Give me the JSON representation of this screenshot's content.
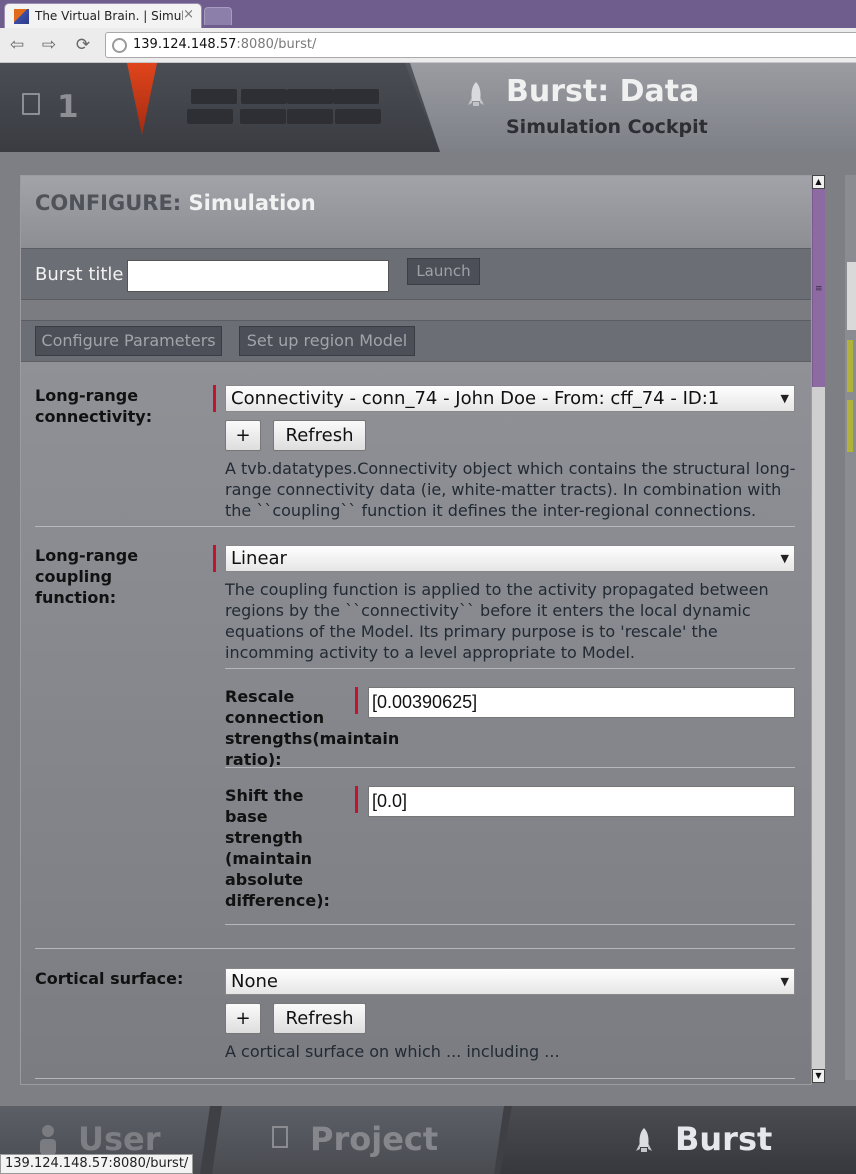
{
  "browser": {
    "tab_title": "The Virtual Brain. | Simulation",
    "tab_close": "×",
    "url_host": "139.124.148.57",
    "url_rest": ":8080/burst/",
    "status_url": "139.124.148.57:8080/burst/"
  },
  "header": {
    "project_count": "1",
    "title": "Burst: Data",
    "subtitle": "Simulation Cockpit"
  },
  "panel": {
    "configure_prefix": "CONFIGURE:",
    "configure_emph": "Simulation",
    "burst_title_label": "Burst title",
    "burst_title_value": "",
    "launch_label": "Launch",
    "configure_params_label": "Configure Parameters",
    "region_model_label": "Set up region Model"
  },
  "fields": {
    "connectivity": {
      "label": "Long-range connectivity:",
      "selected": "Connectivity - conn_74 - John Doe - From: cff_74 - ID:1",
      "add_label": "+",
      "refresh_label": "Refresh",
      "help": "A tvb.datatypes.Connectivity object which contains the structural long-range connectivity data (ie, white-matter tracts). In combination with the ``coupling`` function it defines the inter-regional connections."
    },
    "coupling": {
      "label": "Long-range coupling function:",
      "selected": "Linear",
      "help": "The coupling function is applied to the activity propagated between regions by the ``connectivity`` before it enters the local dynamic equations of the Model. Its primary purpose is to 'rescale' the incomming activity to a level appropriate to Model.",
      "rescale_label": "Rescale connection strengths(maintain ratio):",
      "rescale_value": "[0.00390625]",
      "shift_label": "Shift the base strength (maintain absolute difference):",
      "shift_value": "[0.0]"
    },
    "cortical": {
      "label": "Cortical surface:",
      "selected": "None",
      "add_label": "+",
      "refresh_label": "Refresh",
      "help": "A cortical surface on which ... including ..."
    }
  },
  "bottom_nav": {
    "user": "User",
    "project": "Project",
    "burst": "Burst"
  },
  "colors": {
    "required_marker": "#c4142d",
    "scroll_thumb": "#8e6aa2",
    "header_pointer": "#e0451c"
  }
}
